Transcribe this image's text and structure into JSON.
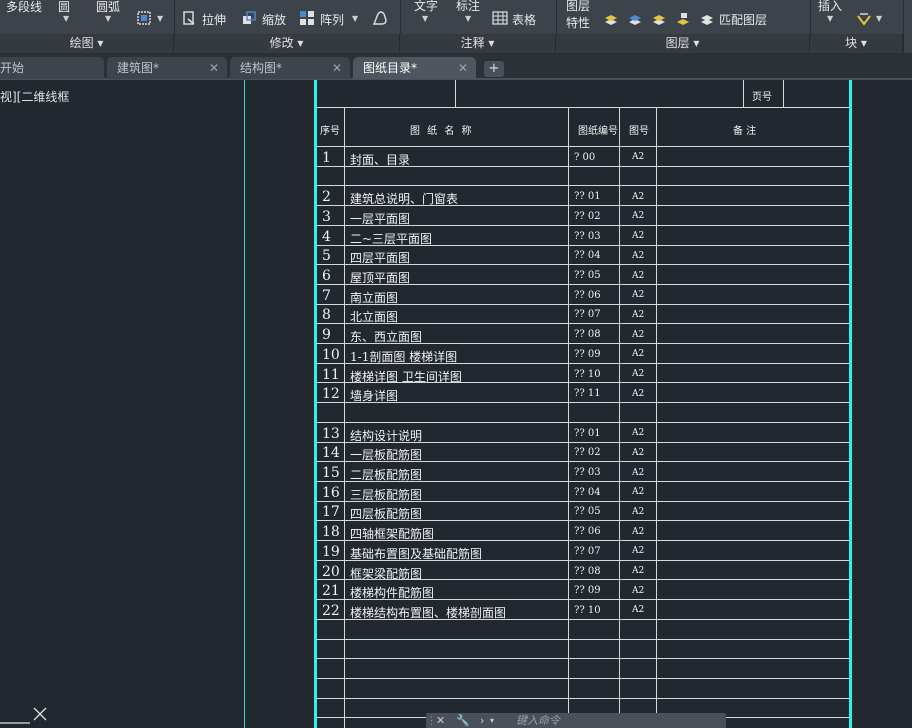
{
  "ribbon": {
    "draw": {
      "polyline": "多段线",
      "circle": "圆",
      "arc": "圆弧"
    },
    "modify": {
      "stretch": "拉伸",
      "scale": "缩放",
      "array": "阵列"
    },
    "annotate": {
      "text": "文字",
      "dimension": "标注",
      "table": "表格"
    },
    "layers": {
      "layer_props_line1": "图层",
      "layer_props_line2": "特性",
      "match_layer": "匹配图层"
    },
    "block": {
      "insert": "插入"
    },
    "groups": [
      "绘图",
      "修改",
      "注释",
      "图层",
      "块"
    ]
  },
  "tabs": [
    {
      "label": "开始"
    },
    {
      "label": "建筑图*"
    },
    {
      "label": "结构图*"
    },
    {
      "label": "图纸目录*",
      "active": true
    }
  ],
  "viewport_label": "视][二维线框",
  "sheet": {
    "page_header": "页号",
    "columns": [
      "序号",
      "图 纸 名 称",
      "图纸编号",
      "图号",
      "备 注"
    ],
    "rows": [
      {
        "no": "1",
        "name": "封面、目录",
        "code": "? 00",
        "size": "A2"
      },
      {
        "no": "",
        "name": "",
        "code": "",
        "size": ""
      },
      {
        "no": "2",
        "name": "建筑总说明、门窗表",
        "code": "?? 01",
        "size": "A2"
      },
      {
        "no": "3",
        "name": "一层平面图",
        "code": "?? 02",
        "size": "A2"
      },
      {
        "no": "4",
        "name": "二~三层平面图",
        "code": "?? 03",
        "size": "A2"
      },
      {
        "no": "5",
        "name": "四层平面图",
        "code": "?? 04",
        "size": "A2"
      },
      {
        "no": "6",
        "name": "屋顶平面图",
        "code": "?? 05",
        "size": "A2"
      },
      {
        "no": "7",
        "name": "南立面图",
        "code": "?? 06",
        "size": "A2"
      },
      {
        "no": "8",
        "name": "北立面图",
        "code": "?? 07",
        "size": "A2"
      },
      {
        "no": "9",
        "name": "东、西立面图",
        "code": "?? 08",
        "size": "A2"
      },
      {
        "no": "10",
        "name": "1-1剖面图 楼梯详图",
        "code": "?? 09",
        "size": "A2"
      },
      {
        "no": "11",
        "name": "楼梯详图 卫生间详图",
        "code": "?? 10",
        "size": "A2"
      },
      {
        "no": "12",
        "name": "墙身详图",
        "code": "?? 11",
        "size": "A2"
      },
      {
        "no": "",
        "name": "",
        "code": "",
        "size": ""
      },
      {
        "no": "13",
        "name": "结构设计说明",
        "code": "?? 01",
        "size": "A2"
      },
      {
        "no": "14",
        "name": "一层板配筋图",
        "code": "?? 02",
        "size": "A2"
      },
      {
        "no": "15",
        "name": "二层板配筋图",
        "code": "?? 03",
        "size": "A2"
      },
      {
        "no": "16",
        "name": "三层板配筋图",
        "code": "?? 04",
        "size": "A2"
      },
      {
        "no": "17",
        "name": "四层板配筋图",
        "code": "?? 05",
        "size": "A2"
      },
      {
        "no": "18",
        "name": "四轴框架配筋图",
        "code": "?? 06",
        "size": "A2"
      },
      {
        "no": "19",
        "name": "基础布置图及基础配筋图",
        "code": "?? 07",
        "size": "A2"
      },
      {
        "no": "20",
        "name": "框架梁配筋图",
        "code": "?? 08",
        "size": "A2"
      },
      {
        "no": "21",
        "name": "楼梯构件配筋图",
        "code": "?? 09",
        "size": "A2"
      },
      {
        "no": "22",
        "name": "楼梯结构布置图、楼梯剖面图",
        "code": "?? 10",
        "size": "A2"
      }
    ]
  },
  "command_line": {
    "placeholder": "键入命令"
  },
  "colors": {
    "accent_cyan": "#2ff0f0",
    "canvas": "#212830",
    "ribbon": "#3d434b"
  }
}
